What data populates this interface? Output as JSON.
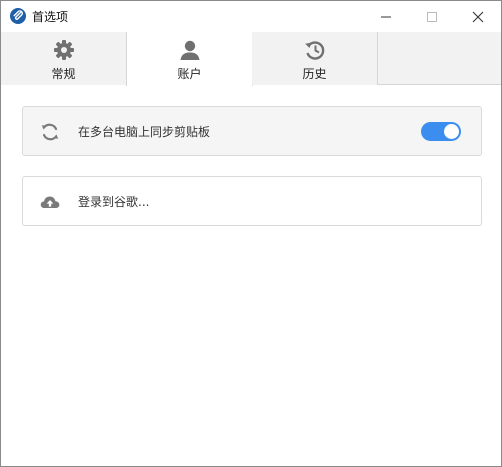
{
  "window": {
    "title": "首选项",
    "app_icon": "paperclip-icon",
    "controls": [
      "minimize-icon",
      "maximize-icon",
      "close-icon"
    ]
  },
  "tabs": [
    {
      "label": "常规",
      "icon": "gear-icon",
      "active": false
    },
    {
      "label": "账户",
      "icon": "user-icon",
      "active": true
    },
    {
      "label": "历史",
      "icon": "history-icon",
      "active": false
    }
  ],
  "sync": {
    "label": "在多台电脑上同步剪贴板",
    "icon": "sync-icon",
    "enabled": true
  },
  "login": {
    "label": "登录到谷歌...",
    "icon": "cloud-upload-icon"
  },
  "colors": {
    "accent": "#3c8df0",
    "app_icon": "#1f5fa8",
    "icon_gray": "#7a7a7a"
  }
}
